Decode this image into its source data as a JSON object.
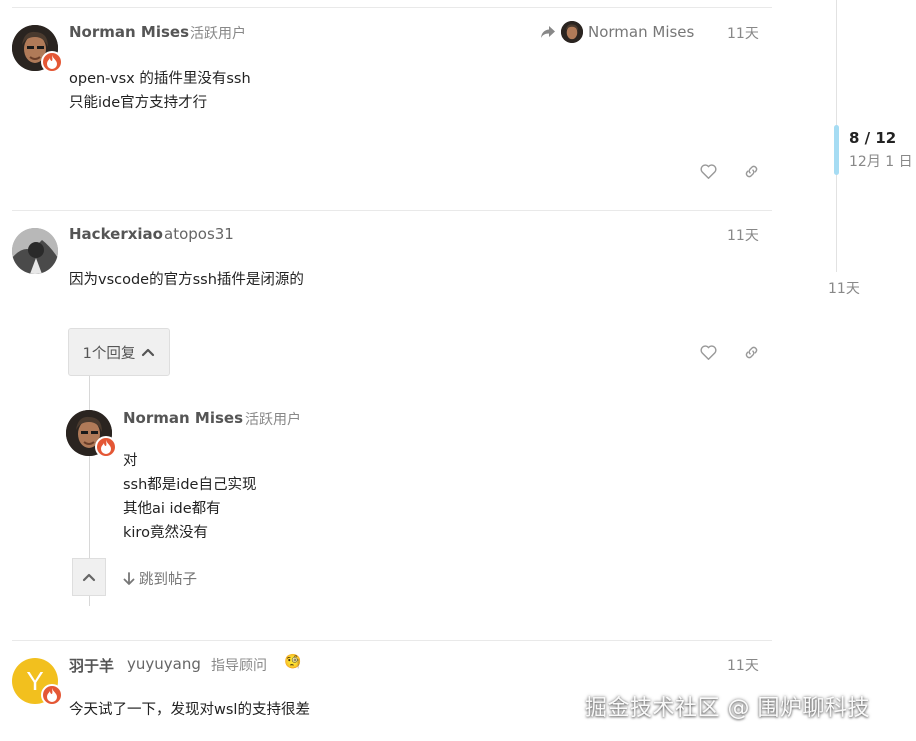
{
  "posts": [
    {
      "username": "Norman Mises",
      "user_title": "活跃用户",
      "reply_to_name": "Norman Mises",
      "time": "11天",
      "lines": [
        "open-vsx 的插件里没有ssh",
        "只能ide官方支持才行"
      ],
      "avatar_icon": "portrait-icon",
      "badge_icon": "flame-icon"
    },
    {
      "username": "Hackerxiao",
      "alias": "atopos31",
      "time": "11天",
      "lines": [
        "因为vscode的官方ssh插件是闭源的"
      ],
      "replies_label": "1个回复"
    },
    {
      "username": "羽于羊",
      "alias": "yuyuyang",
      "user_title": "指导顾问",
      "title_emoji": "🧐",
      "avatar_letter": "Y",
      "time": "11天",
      "lines": [
        "今天试了一下，发现对wsl的支持很差"
      ]
    }
  ],
  "nested_reply": {
    "username": "Norman Mises",
    "user_title": "活跃用户",
    "lines": [
      "对",
      "ssh都是ide自己实现",
      "其他ai ide都有",
      "kiro竟然没有"
    ],
    "jump_label": "跳到帖子"
  },
  "timeline": {
    "position": "8 / 12",
    "date": "12月 1 日",
    "end_label": "11天"
  },
  "watermark": "掘金技术社区 @ 围炉聊科技",
  "colors": {
    "badge": "#e45735",
    "timeline_handle": "#a6dcf3",
    "avatar_yellow": "#f2c01e"
  }
}
